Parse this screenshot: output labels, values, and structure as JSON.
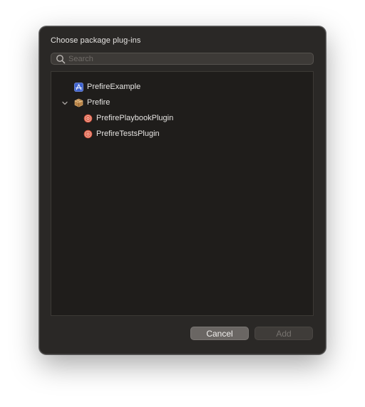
{
  "dialog": {
    "title": "Choose package plug-ins"
  },
  "search": {
    "placeholder": "Search",
    "value": ""
  },
  "tree": {
    "items": [
      {
        "label": "PrefireExample",
        "icon": "app-target-icon",
        "level": 0,
        "expandable": false
      },
      {
        "label": "Prefire",
        "icon": "package-icon",
        "level": 0,
        "expandable": true,
        "expanded": true
      },
      {
        "label": "PrefirePlaybookPlugin",
        "icon": "plugin-target-icon",
        "level": 1,
        "expandable": false
      },
      {
        "label": "PrefireTestsPlugin",
        "icon": "plugin-target-icon",
        "level": 1,
        "expandable": false
      }
    ]
  },
  "buttons": {
    "cancel_label": "Cancel",
    "add_label": "Add",
    "add_enabled": false
  },
  "colors": {
    "dialog_bg": "#2a2826",
    "list_bg": "#1f1d1b",
    "app_icon": "#4b6fd6",
    "package_icon": "#c99a5b",
    "plugin_icon": "#e0654e"
  }
}
